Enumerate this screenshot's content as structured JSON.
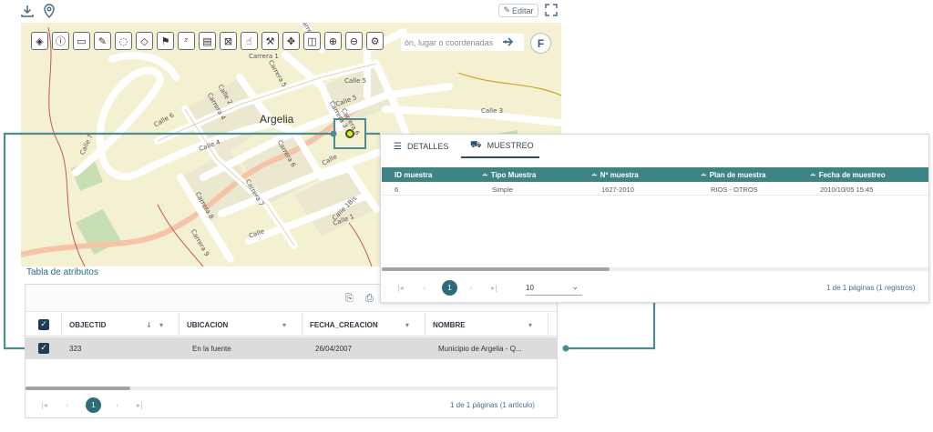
{
  "toolbar": {
    "edit_label": "Editar",
    "tools": [
      {
        "icon": "layers-icon",
        "glyph": "◈"
      },
      {
        "icon": "info-icon",
        "glyph": "ⓘ"
      },
      {
        "icon": "measure-icon",
        "glyph": "▭"
      },
      {
        "icon": "pencil-icon",
        "glyph": "✎"
      },
      {
        "icon": "comment-icon",
        "glyph": "◌"
      },
      {
        "icon": "eraser-icon",
        "glyph": "◇"
      },
      {
        "icon": "flag-icon",
        "glyph": "⚑"
      },
      {
        "icon": "xy-icon",
        "glyph": "ᶻ"
      },
      {
        "icon": "print-icon",
        "glyph": "▤"
      },
      {
        "icon": "select-area-icon",
        "glyph": "⊠"
      },
      {
        "icon": "hand-icon",
        "glyph": "☝"
      },
      {
        "icon": "tools-icon",
        "glyph": "⚒"
      },
      {
        "icon": "move-icon",
        "glyph": "✥"
      },
      {
        "icon": "split-icon",
        "glyph": "◫"
      },
      {
        "icon": "zoom-in-icon",
        "glyph": "⊕"
      },
      {
        "icon": "zoom-out-icon",
        "glyph": "⊖"
      },
      {
        "icon": "settings-icon",
        "glyph": "⚙"
      }
    ],
    "search_placeholder": "ón, lugar o coordenadas",
    "f_button": "F"
  },
  "map": {
    "town": "Argelia",
    "streets": [
      {
        "label": "Calle 6"
      },
      {
        "label": "Calle 4"
      },
      {
        "label": "Calle 5"
      },
      {
        "label": "Calle 3"
      },
      {
        "label": "Carrera 3"
      },
      {
        "label": "Carrera 5"
      },
      {
        "label": "Carrera 6"
      },
      {
        "label": "Carrera 7"
      },
      {
        "label": "Carrera 8"
      },
      {
        "label": "Carrera 9"
      },
      {
        "label": "Carrera 4"
      },
      {
        "label": "Calle 1Bis"
      },
      {
        "label": "Calle"
      },
      {
        "label": "Calle 1"
      },
      {
        "label": "Calle 2"
      },
      {
        "label": "Calle 7"
      },
      {
        "label": "Calle"
      },
      {
        "label": "Carrera 1"
      },
      {
        "label": "Carrera 6"
      },
      {
        "label": "Carrera 3"
      },
      {
        "label": "Calle 5"
      }
    ]
  },
  "attributes": {
    "title": "Tabla de atributos",
    "columns": [
      "OBJECTID",
      "UBICACION",
      "FECHA_CREACION",
      "NOMBRE"
    ],
    "rows": [
      {
        "objectid": "323",
        "ubicacion": "En la fuente",
        "fecha": "26/04/2007",
        "nombre": "Municipio de Argelia - Q..."
      }
    ],
    "page": "1",
    "pager_text": "1 de 1 páginas (1 artículo)"
  },
  "popup": {
    "tabs": [
      "DETALLES",
      "MUESTREO"
    ],
    "active_tab": "MUESTREO",
    "columns": [
      "ID muestra",
      "Tipo Muestra",
      "Nº muestra",
      "Plan de muestra",
      "Fecha de muestreo"
    ],
    "rows": [
      {
        "id": "6",
        "tipo": "Simple",
        "numero": "1627-2010",
        "plan": "RIOS - OTROS",
        "fecha": "2010/10/05 15:45"
      }
    ],
    "page": "1",
    "page_size": "10",
    "pager_text": "1 de 1 páginas (1 registros)"
  },
  "colors": {
    "accent": "#3e8485",
    "callout": "#4e8c92",
    "header_dark": "#1d3d5a"
  }
}
